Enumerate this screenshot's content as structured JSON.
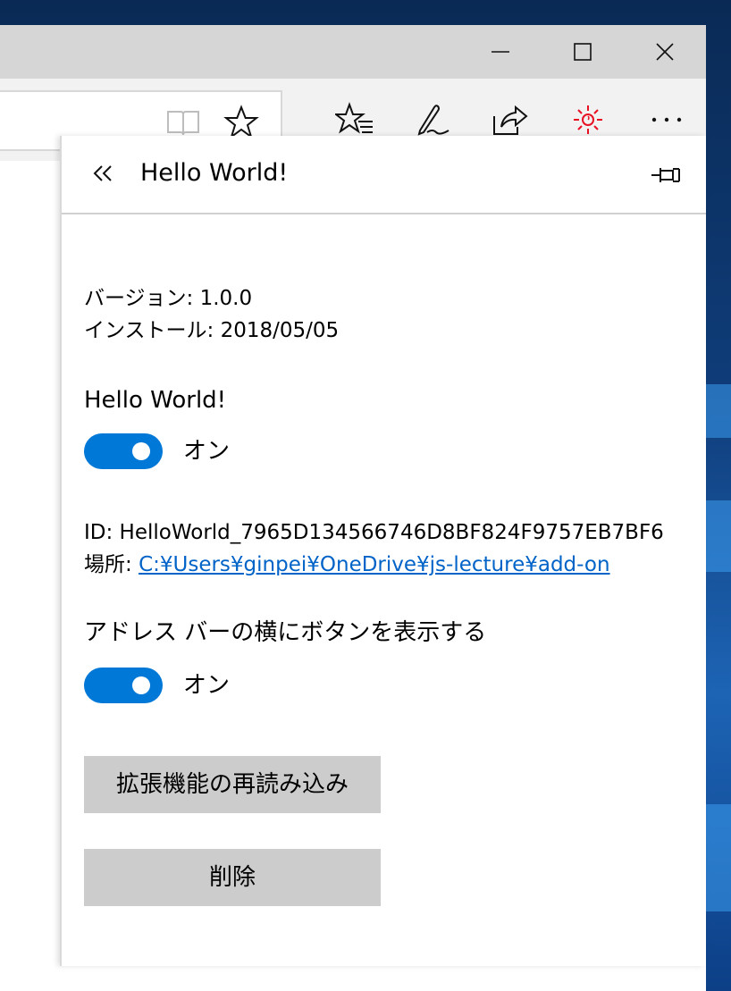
{
  "window": {
    "caption_buttons": [
      "minimize-icon",
      "maximize-icon",
      "close-icon"
    ]
  },
  "toolbar": {
    "address_icons": [
      "reading-view-icon",
      "favorite-star-icon"
    ],
    "icons": [
      "favorites-hub-icon",
      "web-note-icon",
      "share-icon",
      "extension-sun-icon",
      "more-icon"
    ],
    "extension_icon_color": "#e81123"
  },
  "panel": {
    "title": "Hello World!",
    "version": "バージョン: 1.0.0",
    "installed": "インストール: 2018/05/05",
    "enable_heading": "Hello World!",
    "enable_toggle": {
      "state": "オン",
      "on": true
    },
    "id_text": "ID: HelloWorld_7965D134566746D8BF824F9757EB7BF6",
    "location_label": "場所: ",
    "location_link": "C:¥Users¥ginpei¥OneDrive¥js-lecture¥add-on",
    "addressbar_heading": "アドレス バーの横にボタンを表示する",
    "addressbar_toggle": {
      "state": "オン",
      "on": true
    },
    "reload_button": "拡張機能の再読み込み",
    "remove_button": "削除"
  },
  "colors": {
    "accent": "#0078d7",
    "link": "#0063c8",
    "button_bg": "#cccccc",
    "titlebar": "#d6d6d6"
  }
}
